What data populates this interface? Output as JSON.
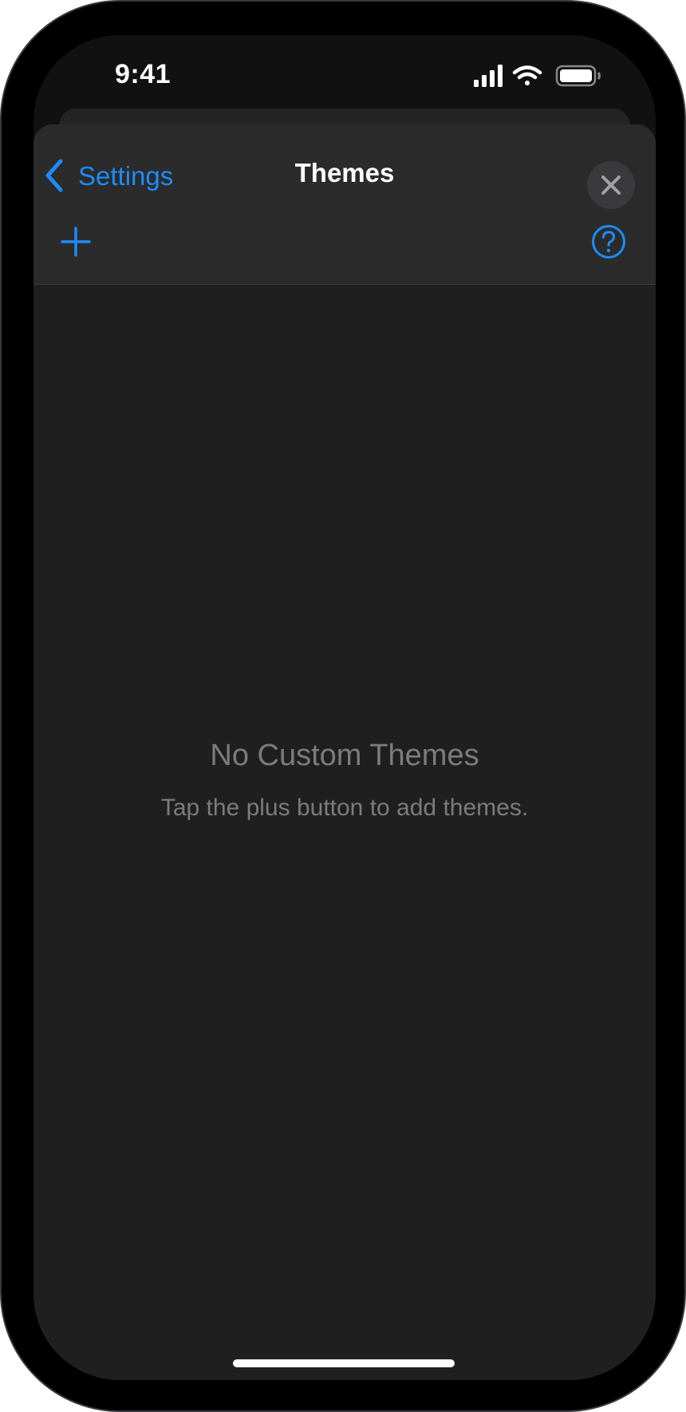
{
  "status_bar": {
    "time": "9:41"
  },
  "nav": {
    "back_label": "Settings",
    "title": "Themes"
  },
  "empty_state": {
    "title": "No Custom Themes",
    "subtitle": "Tap the plus button to add themes."
  },
  "colors": {
    "accent": "#1d8cf8",
    "sheet_background": "#1f1f1f",
    "nav_background": "#2b2b2b",
    "secondary_text": "#7c7c7e"
  },
  "icons": {
    "back": "chevron-left-icon",
    "close": "close-icon",
    "add": "plus-icon",
    "help": "question-circle-icon",
    "signal": "cellular-signal-icon",
    "wifi": "wifi-icon",
    "battery": "battery-icon"
  }
}
